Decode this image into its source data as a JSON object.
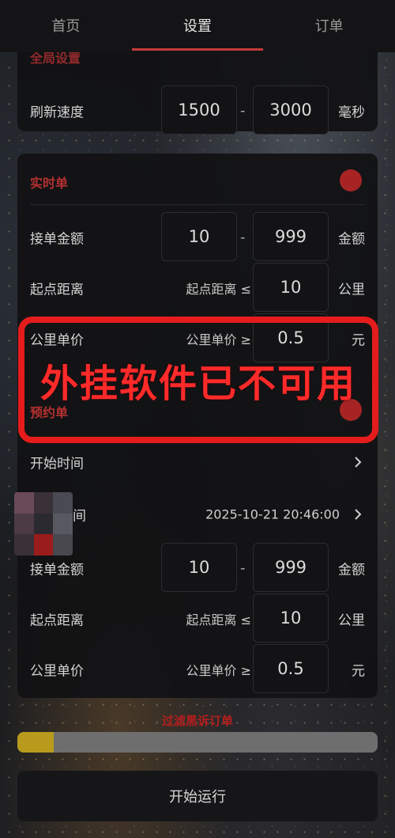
{
  "nav": {
    "tabs": [
      {
        "label": "首页"
      },
      {
        "label": "设置"
      },
      {
        "label": "订单"
      }
    ],
    "active_index": 1,
    "accent_color": "#c43a3a"
  },
  "global_settings": {
    "title": "全局设置",
    "refresh": {
      "label": "刷新速度",
      "min": "1500",
      "max": "3000",
      "unit": "毫秒",
      "separator": "-"
    }
  },
  "realtime": {
    "title": "实时单",
    "toggle_color": "#a82424",
    "amount": {
      "label": "接单金额",
      "min": "10",
      "max": "999",
      "unit": "金额",
      "separator": "-"
    },
    "distance": {
      "label": "起点距离",
      "condition": "起点距离 ≤",
      "value": "10",
      "unit": "公里"
    },
    "price": {
      "label": "公里单价",
      "condition": "公里单价 ≥",
      "value": "0.5",
      "unit": "元"
    }
  },
  "reservation": {
    "title": "预约单",
    "start_time": {
      "label": "开始时间"
    },
    "end_time": {
      "label": "间",
      "value": "2025-10-21 20:46:00"
    },
    "amount": {
      "label": "接单金额",
      "min": "10",
      "max": "999",
      "unit": "金额",
      "separator": "-"
    },
    "distance": {
      "label": "起点距离",
      "condition": "起点距离 ≤",
      "value": "10",
      "unit": "公里"
    },
    "price": {
      "label": "公里单价",
      "condition": "公里单价 ≥",
      "value": "0.5",
      "unit": "元"
    }
  },
  "warning": {
    "text": "外挂软件已不可用",
    "color": "#e41c1c"
  },
  "progress": {
    "label": "过滤黑诉订单",
    "fraction": 0.1
  },
  "start_button": {
    "label": "开始运行"
  },
  "icons": [
    "chevron-right-icon",
    "toggle-dot-icon"
  ]
}
